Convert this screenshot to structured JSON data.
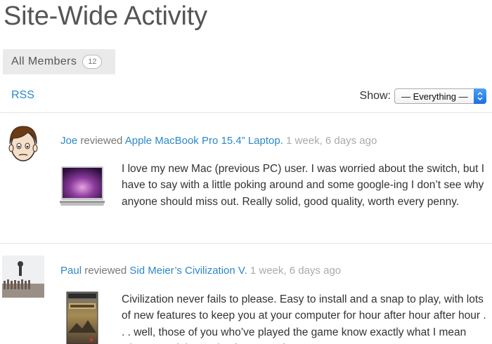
{
  "page": {
    "title": "Site-Wide Activity"
  },
  "tabs": {
    "all_members_label": "All Members",
    "all_members_count": "12"
  },
  "toolbar": {
    "rss_label": "RSS",
    "show_label": "Show:",
    "filter_value": "— Everything —"
  },
  "activity": [
    {
      "user": "Joe",
      "action": "reviewed",
      "item": "Apple MacBook Pro 15.4” Laptop.",
      "time": "1 week, 6 days ago",
      "review": "I love my new Mac (previous PC) user. I was worried about the switch, but I have to say with a little poking around and some google-ing I don’t see why anyone should miss out. Really solid, good quality, worth every penny."
    },
    {
      "user": "Paul",
      "action": "reviewed",
      "item": "Sid Meier’s Civilization V.",
      "time": "1 week, 6 days ago",
      "review": "Civilization never fails to please. Easy to install and a snap to play, with lots of new features to keep you at your computer for hour after hour after hour . . . well, those of you who’ve played the game know exactly what I mean when I say it is an absolute must-have."
    }
  ],
  "colors": {
    "link": "#2b88c9",
    "title": "#555555",
    "timestamp": "#aaaaaa",
    "tab_background": "#eaeaea",
    "select_accent": "#2f84ee"
  },
  "icons": {
    "select_arrows": "updown-chevron-icon"
  }
}
